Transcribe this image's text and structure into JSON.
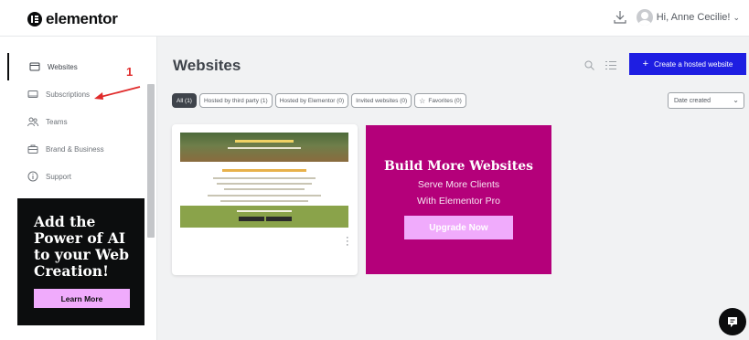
{
  "header": {
    "logo_text": "elementor",
    "greeting": "Hi, Anne Cecilie!",
    "icons": [
      "download-icon",
      "avatar",
      "chevron-down-icon"
    ]
  },
  "sidebar": {
    "items": [
      {
        "label": "Websites",
        "icon": "browser-window-icon",
        "active": true
      },
      {
        "label": "Subscriptions",
        "icon": "card-icon",
        "active": false
      },
      {
        "label": "Teams",
        "icon": "people-icon",
        "active": false
      },
      {
        "label": "Brand & Business",
        "icon": "briefcase-icon",
        "active": false
      },
      {
        "label": "Support",
        "icon": "info-icon",
        "active": false
      }
    ],
    "annotation_number": "1",
    "annotation_color": "#e02b2b",
    "promo": {
      "title": "Add the Power of AI to your Web Creation!",
      "button": "Learn More",
      "background": "#0c0d0e",
      "button_color": "#f0abfc"
    }
  },
  "main": {
    "title": "Websites",
    "create_button": "Create a hosted website",
    "create_button_icon": "+",
    "create_button_color": "#1e1ee2",
    "filters": [
      {
        "label": "All (1)",
        "active": true
      },
      {
        "label": "Hosted by third party (1)",
        "active": false
      },
      {
        "label": "Hosted by Elementor (0)",
        "active": false
      },
      {
        "label": "Invited websites (0)",
        "active": false
      },
      {
        "label": "Favorites (0)",
        "active": false,
        "icon": "star-icon"
      }
    ],
    "sort": {
      "selected": "Date created"
    },
    "upsell": {
      "title": "Build More Websites",
      "line1": "Serve More Clients",
      "line2": "With Elementor Pro",
      "button": "Upgrade Now",
      "background": "#b4007a"
    }
  }
}
